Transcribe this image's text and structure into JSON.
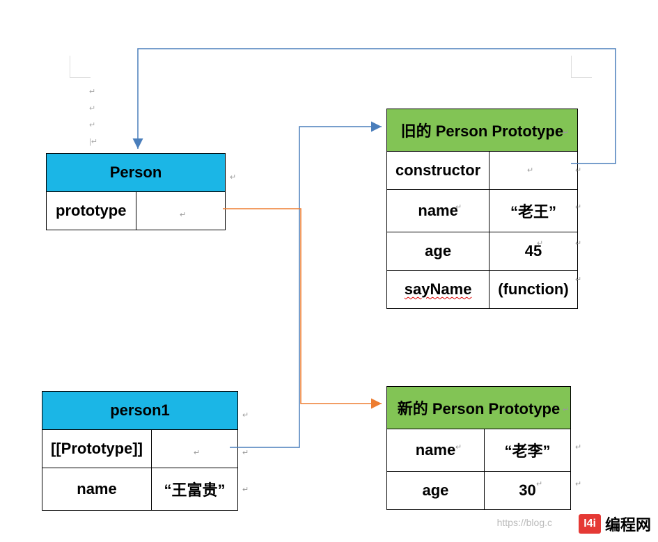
{
  "chart_data": {
    "type": "diagram",
    "description": "JavaScript prototype relationship diagram",
    "nodes": [
      {
        "id": "person_constructor",
        "title": "Person",
        "header_color": "#1BB6E6",
        "rows": [
          {
            "key": "prototype",
            "value": ""
          }
        ]
      },
      {
        "id": "old_person_prototype",
        "title": "旧的 Person Prototype",
        "header_color": "#82C455",
        "rows": [
          {
            "key": "constructor",
            "value": ""
          },
          {
            "key": "name",
            "value": "\"老王\""
          },
          {
            "key": "age",
            "value": 45
          },
          {
            "key": "sayName",
            "value": "(function)"
          }
        ]
      },
      {
        "id": "person1_instance",
        "title": "person1",
        "header_color": "#1BB6E6",
        "rows": [
          {
            "key": "[[Prototype]]",
            "value": ""
          },
          {
            "key": "name",
            "value": "\"王富贵\""
          }
        ]
      },
      {
        "id": "new_person_prototype",
        "title": "新的 Person Prototype",
        "header_color": "#82C455",
        "rows": [
          {
            "key": "name",
            "value": "\"老李\""
          },
          {
            "key": "age",
            "value": 30
          }
        ]
      }
    ],
    "edges": [
      {
        "from": "old_person_prototype.constructor",
        "to": "person_constructor",
        "color": "#4A7EBB"
      },
      {
        "from": "person1_instance.[[Prototype]]",
        "to": "old_person_prototype",
        "color": "#4A7EBB"
      },
      {
        "from": "person_constructor.prototype",
        "to": "new_person_prototype",
        "color": "#ED7D31"
      }
    ]
  },
  "boxes": {
    "person": {
      "title": "Person",
      "row0_key": "prototype",
      "row0_val": ""
    },
    "old_proto": {
      "title": "旧的 Person Prototype",
      "r0k": "constructor",
      "r0v": "",
      "r1k": "name",
      "r1v": "“老王”",
      "r2k": "age",
      "r2v": "45",
      "r3k": "sayName",
      "r3v": "(function)"
    },
    "person1": {
      "title": "person1",
      "r0k": "[[Prototype]]",
      "r0v": "",
      "r1k": "name",
      "r1v": "“王富贵”"
    },
    "new_proto": {
      "title": "新的 Person Prototype",
      "r0k": "name",
      "r0v": "“老李”",
      "r1k": "age",
      "r1v": "30"
    }
  },
  "marks": {
    "ret": "↵"
  },
  "watermark": "https://blog.c",
  "brand": {
    "badge": "I4i",
    "text": "编程网"
  }
}
